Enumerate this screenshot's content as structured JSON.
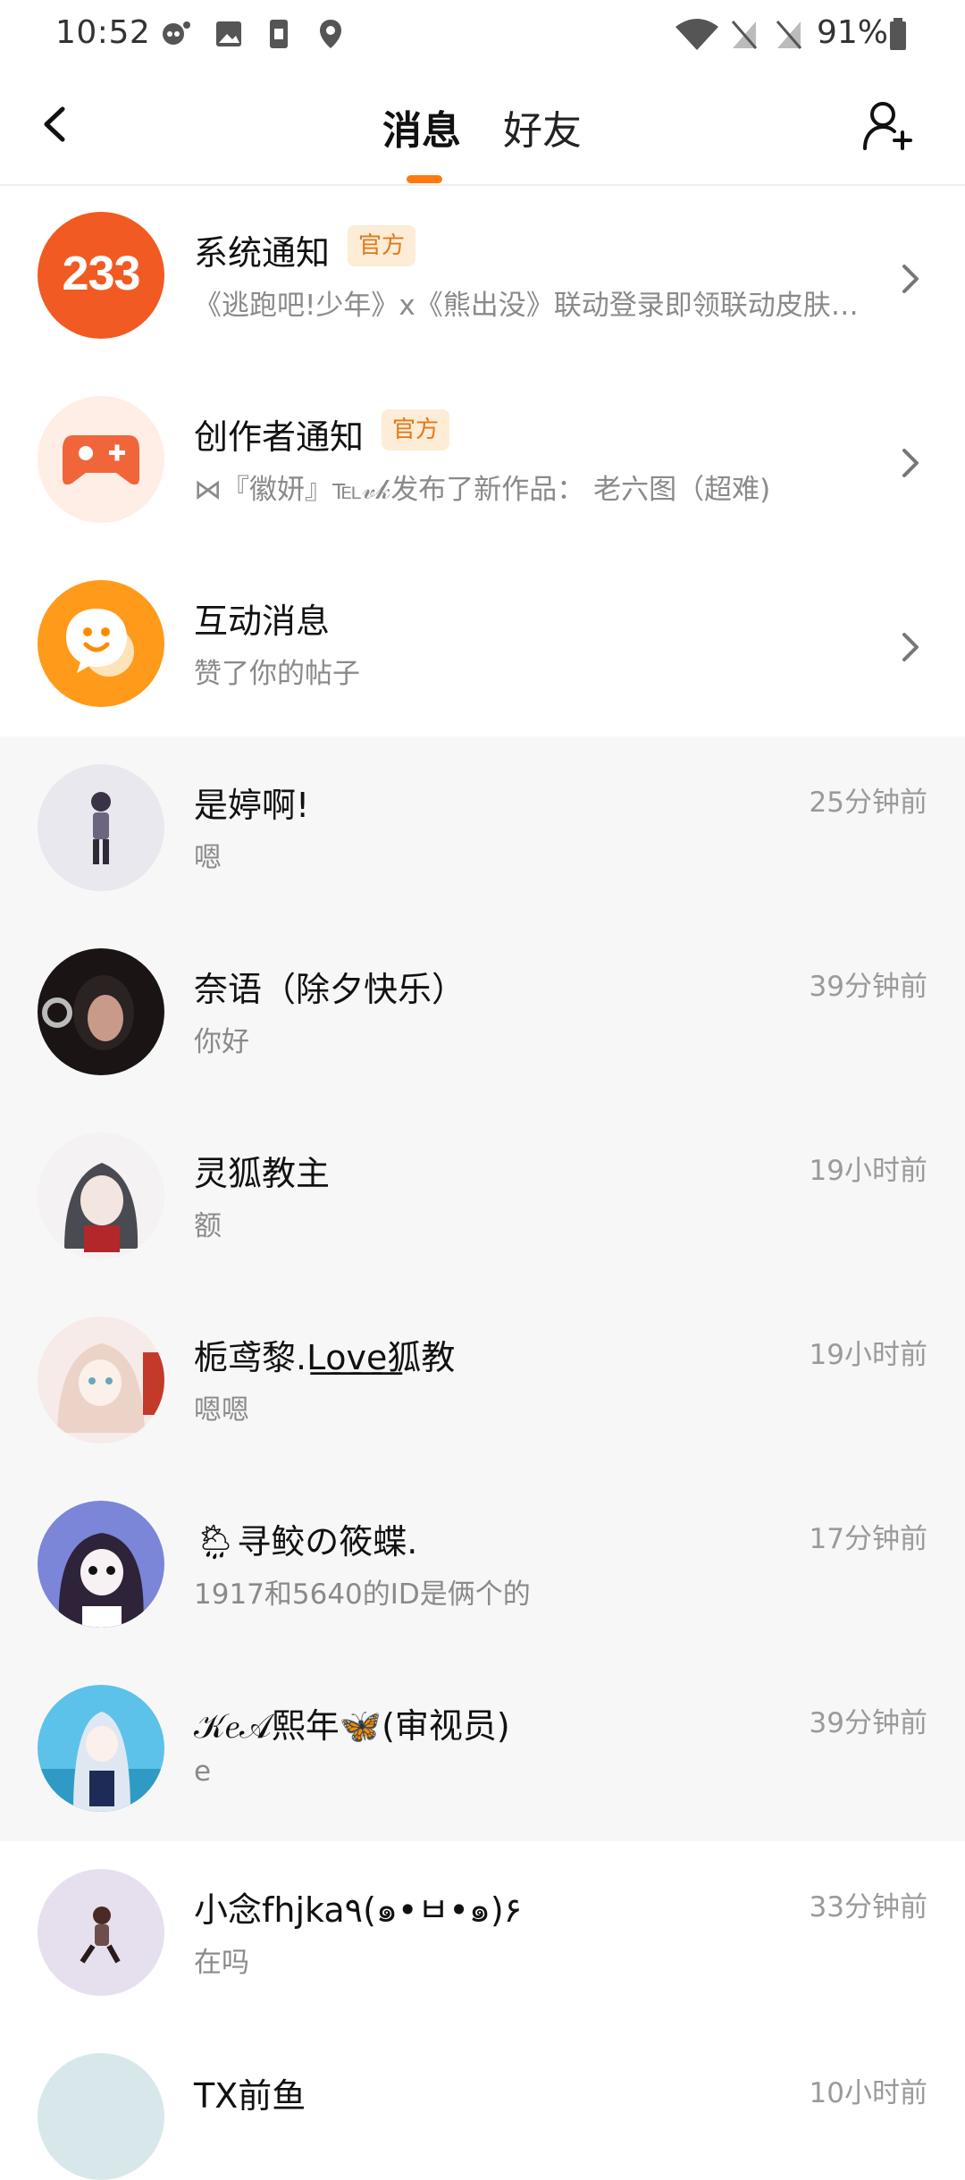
{
  "status_bar": {
    "time": "10:52",
    "battery": "91%",
    "icons_left": [
      "notification-icon",
      "image-icon",
      "sim-icon",
      "location-icon"
    ],
    "icons_right": [
      "wifi-icon",
      "no-signal-icon",
      "no-signal-icon-2",
      "battery-icon"
    ]
  },
  "header": {
    "tab_messages": "消息",
    "tab_friends": "好友",
    "accent_color": "#ff7a10"
  },
  "official_items": [
    {
      "title": "系统通知",
      "badge": "官方",
      "subtitle": "《逃跑吧!少年》x《熊出没》联动登录即领联动皮肤…",
      "avatar_text": "233",
      "avatar_color": "#f15a22"
    },
    {
      "title": "创作者通知",
      "badge": "官方",
      "subtitle": "⋈『徽妍』℡𝓋𝓀发布了新作品：  老六图（超难)",
      "avatar_icon": "gamepad-icon",
      "avatar_color": "#ffeee6"
    },
    {
      "title": "互动消息",
      "subtitle": "赞了你的帖子",
      "avatar_icon": "chat-smile-icon",
      "avatar_color": "#ff9a1a"
    }
  ],
  "chats": [
    {
      "name": "是婷啊!",
      "message": "嗯",
      "time": "25分钟前"
    },
    {
      "name": "奈语（除夕快乐）",
      "message": "你好",
      "time": "39分钟前"
    },
    {
      "name": "灵狐教主",
      "message": "额",
      "time": "19小时前"
    },
    {
      "name": "栀鸢黎.L͟o͟v͟e͟狐教",
      "message": "嗯嗯",
      "time": "19小时前"
    },
    {
      "name": "🌦寻鲛の筱蝶.",
      "message": "1917和5640的ID是俩个的",
      "time": "17分钟前"
    },
    {
      "name": "𝒦𝑒𝒜熙年🦋(审视员)",
      "message": "e",
      "time": "39分钟前"
    },
    {
      "name": "小念fhjka٩(๑•ㅂ•๑)۶",
      "message": "在吗",
      "time": "33分钟前"
    },
    {
      "name": "TX前鱼",
      "message": "",
      "time": "10小时前"
    }
  ]
}
